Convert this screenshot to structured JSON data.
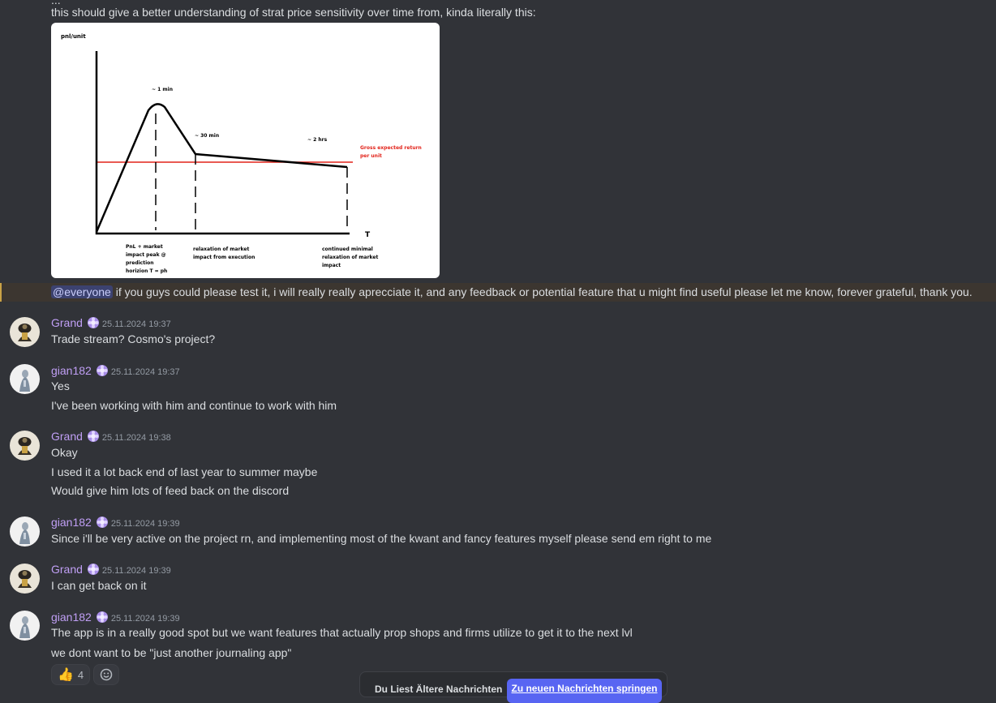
{
  "messages": {
    "intro_cutoff": "...",
    "intro_line": "this should give a better understanding of strat price sensitivity over time from, kinda literally this:",
    "chart_text": {
      "y_label": "pnl/unit",
      "x_label": "T",
      "peak_label": "~ 1 min",
      "mid_label": "~ 30 min",
      "late_label": "~ 2 hrs",
      "red_label_1": "Gross expected return",
      "red_label_2": "per unit",
      "ann1_1": "PnL + market",
      "ann1_2": "impact peak @",
      "ann1_3": "prediction",
      "ann1_4": "horizion T = ph",
      "ann2_1": "relaxation of market",
      "ann2_2": "impact from execution",
      "ann3_1": "continued minimal",
      "ann3_2": "relaxation of market",
      "ann3_3": "impact"
    },
    "everyone_mention": "@everyone",
    "everyone_text": " if you guys could please test it, i will really really aprecciate it, and any feedback or potential feature that u might find useful please let me know, forever grateful, thank you.",
    "groups": [
      {
        "username": "Grand",
        "timestamp": "25.11.2024 19:37",
        "lines": [
          "Trade stream? Cosmo's project?"
        ]
      },
      {
        "username": "gian182",
        "timestamp": "25.11.2024 19:37",
        "lines": [
          "Yes",
          "I've been working with him and continue to work with him"
        ]
      },
      {
        "username": "Grand",
        "timestamp": "25.11.2024 19:38",
        "lines": [
          "Okay",
          "I used it a lot back end of last year to summer maybe",
          "Would give him lots of feed back on the discord"
        ]
      },
      {
        "username": "gian182",
        "timestamp": "25.11.2024 19:39",
        "lines": [
          "Since i'll be very active on the project rn, and implementing most of the kwant and fancy features myself please send em right to me"
        ]
      },
      {
        "username": "Grand",
        "timestamp": "25.11.2024 19:39",
        "lines": [
          "I can get back on it"
        ]
      },
      {
        "username": "gian182",
        "timestamp": "25.11.2024 19:39",
        "lines": [
          "The app is in a really good spot but we want features that actually prop shops and firms utilize to get it to the next lvl",
          "we dont want to be \"just another journaling app\""
        ]
      }
    ]
  },
  "reactions": {
    "thumbs_emoji": "👍",
    "thumbs_count": "4",
    "add_icon": "smiley-add-icon"
  },
  "jump_bar": {
    "text": "Du Liest Ältere Nachrichten",
    "button": "Zu neuen Nachrichten springen"
  },
  "colors": {
    "background": "#313338",
    "username": "#c09ff5",
    "accent": "#5865f2",
    "mention_bg": "#3c4270",
    "highlight_border": "#c9a246"
  }
}
